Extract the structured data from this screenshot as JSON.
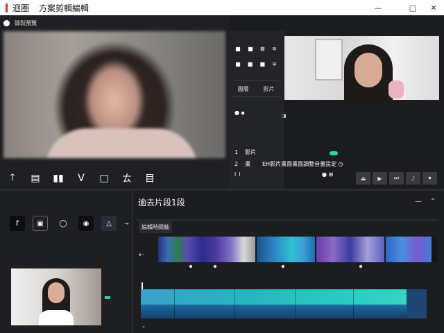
{
  "titlebar": {
    "app_title": "迴圈",
    "subtitle": "方案剪輯編輯",
    "minimize": "—",
    "maximize": "□",
    "close": "✕"
  },
  "preview": {
    "header_label": "錄製預覽",
    "tools": [
      "🡑",
      "▤",
      "▮▮",
      "V",
      "□",
      "ㄊ",
      "目"
    ]
  },
  "mid_panel": {
    "row1": [
      "■",
      "■",
      "⊠",
      "≋"
    ],
    "row2": [
      "■",
      "■",
      "■",
      "≋"
    ],
    "tab1": "圖層",
    "tab2": "影片",
    "dots": "● ▪"
  },
  "right_controls": {
    "panel_close": "◨",
    "rows": [
      {
        "label": "1",
        "text": "影片",
        "value": ""
      },
      {
        "label": "2",
        "text": "畫",
        "value": "EH影片畫面畫面調整音量設定 ◷"
      },
      {
        "label": "l",
        "text": "l",
        "value": "● ⊞"
      }
    ],
    "playback": [
      "⏏",
      "▶",
      "⏭",
      "♪",
      "⏺"
    ]
  },
  "left_lower": {
    "icons": [
      "𝕗",
      "▣",
      "◯",
      "◉",
      "△"
    ],
    "arrow": "→"
  },
  "timeline": {
    "title": "逾去片段1段",
    "collapse": "—",
    "expand": "⌃",
    "tab_label": "編輯時間軸",
    "track_lead": "⇠",
    "bottom_tick": "⌄"
  },
  "colors": {
    "accent": "#2fd3a7",
    "brand_red": "#d0312d",
    "audio_teal": "#27c8c1",
    "audio_blue": "#1b3e6c"
  }
}
